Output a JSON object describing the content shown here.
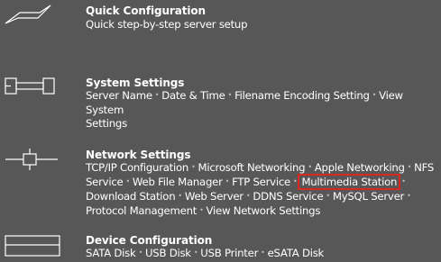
{
  "sections": [
    {
      "title": "Quick Configuration",
      "description": "Quick step-by-step server setup"
    },
    {
      "title": "System Settings",
      "links": [
        "Server Name",
        "Date & Time",
        "Filename Encoding Setting",
        "View System Settings"
      ]
    },
    {
      "title": "Network Settings",
      "links": [
        "TCP/IP Configuration",
        "Microsoft Networking",
        "Apple Networking",
        "NFS Service",
        "Web File Manager",
        "FTP Service",
        "Multimedia Station",
        "Download Station",
        "Web Server",
        "DDNS Service",
        "MySQL Server",
        "Protocol Management",
        "View Network Settings"
      ]
    },
    {
      "title": "Device Configuration",
      "links": [
        "SATA Disk",
        "USB Disk",
        "USB Printer",
        "eSATA Disk"
      ]
    }
  ],
  "highlighted_link": "Multimedia Station",
  "colors": {
    "background": "#575757",
    "text": "#ffffff",
    "highlight_border": "#d8281f"
  }
}
